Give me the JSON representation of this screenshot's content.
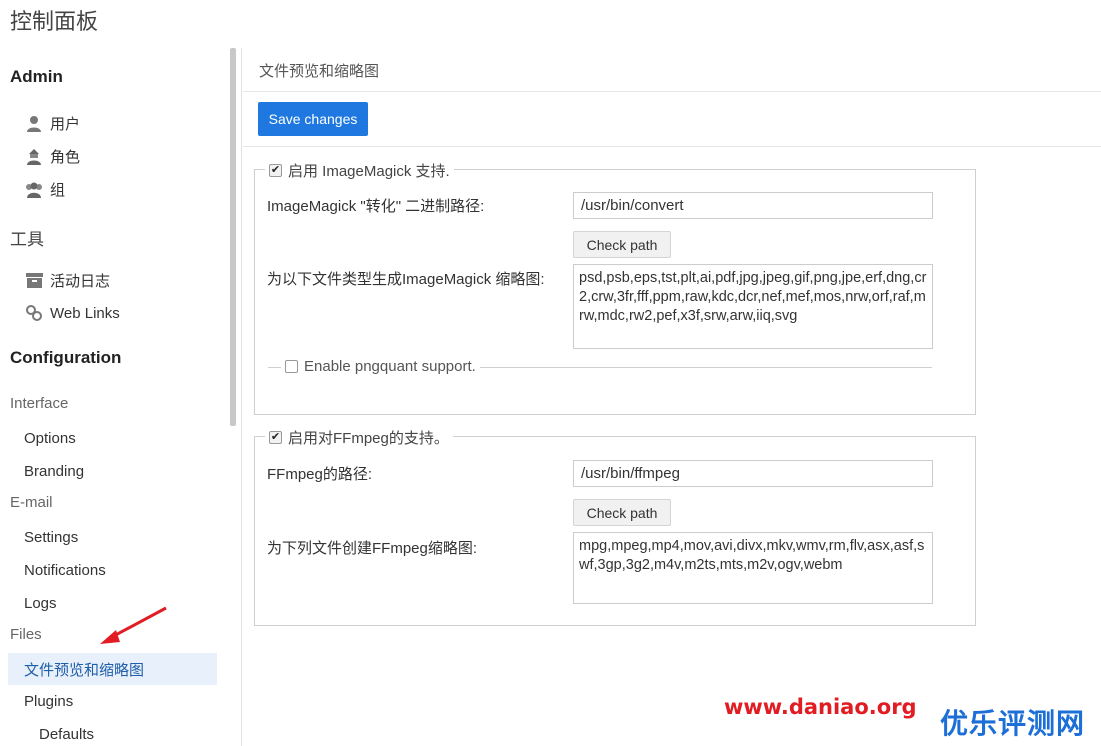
{
  "page": {
    "title": "控制面板"
  },
  "sidebar": {
    "admin_title": "Admin",
    "admin_items": [
      {
        "label": "用户",
        "icon": "user-icon"
      },
      {
        "label": "角色",
        "icon": "role-icon"
      },
      {
        "label": "组",
        "icon": "group-icon"
      }
    ],
    "tools_title": "工具",
    "tools_items": [
      {
        "label": "活动日志",
        "icon": "archive-icon"
      },
      {
        "label": "Web Links",
        "icon": "link-icon"
      }
    ],
    "config_title": "Configuration",
    "interface_heading": "Interface",
    "interface_items": [
      "Options",
      "Branding"
    ],
    "email_heading": "E-mail",
    "email_items": [
      "Settings",
      "Notifications",
      "Logs"
    ],
    "files_heading": "Files",
    "files_active": "文件预览和缩略图",
    "plugins": "Plugins",
    "defaults": "Defaults"
  },
  "main": {
    "heading": "文件预览和缩略图",
    "save_button": "Save changes",
    "imagemagick": {
      "legend": "启用 ImageMagick 支持.",
      "enabled": true,
      "path_label": "ImageMagick \"转化\" 二进制路径:",
      "path_value": "/usr/bin/convert",
      "check_button": "Check path",
      "types_label": "为以下文件类型生成ImageMagick 缩略图:",
      "types_value": "psd,psb,eps,tst,plt,ai,pdf,jpg,jpeg,gif,png,jpe,erf,dng,cr2,crw,3fr,fff,ppm,raw,kdc,dcr,nef,mef,mos,nrw,orf,raf,mrw,mdc,rw2,pef,x3f,srw,arw,iiq,svg",
      "pngquant_label": "Enable pngquant support.",
      "pngquant_enabled": false
    },
    "ffmpeg": {
      "legend": "启用对FFmpeg的支持。",
      "enabled": true,
      "path_label": "FFmpeg的路径:",
      "path_value": "/usr/bin/ffmpeg",
      "check_button": "Check path",
      "types_label": "为下列文件创建FFmpeg缩略图:",
      "types_value": "mpg,mpeg,mp4,mov,avi,divx,mkv,wmv,rm,flv,asx,asf,swf,3gp,3g2,m4v,m2ts,mts,m2v,ogv,webm"
    }
  },
  "watermark": {
    "site": "www.daniao.org",
    "brand": "优乐评测网"
  },
  "colors": {
    "primary": "#1e78e0",
    "active_bg": "#e8f0fb",
    "active_text": "#1f5ea8",
    "arrow": "#e21c23"
  }
}
